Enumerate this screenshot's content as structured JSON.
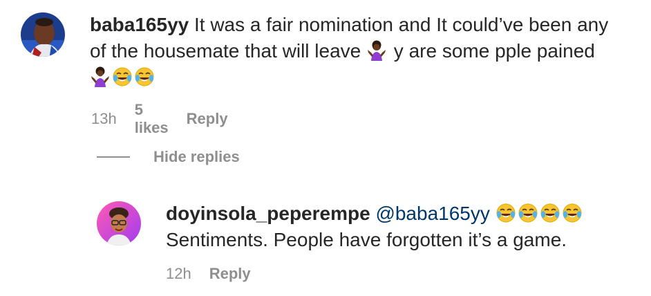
{
  "comments": [
    {
      "username": "baba165yy",
      "text_line1": "It was a fair nomination and It could’ve been any",
      "text_line2_a": "of the housemate that will leave",
      "text_line2_b": "y are some pple pained",
      "time": "13h",
      "likes": "5 likes",
      "reply_label": "Reply"
    }
  ],
  "hide_replies_label": "Hide replies",
  "reply": {
    "username": "doyinsola_peperempe",
    "mention": "@baba165yy",
    "text": "Sentiments. People have forgotten it’s a game.",
    "time": "12h",
    "reply_label": "Reply"
  },
  "icons": {
    "shrug": "woman-shrugging-emoji",
    "laugh": "face-with-tears-of-joy-emoji"
  },
  "colors": {
    "text": "#262626",
    "secondary": "#8e8e8e",
    "mention": "#00376b"
  }
}
